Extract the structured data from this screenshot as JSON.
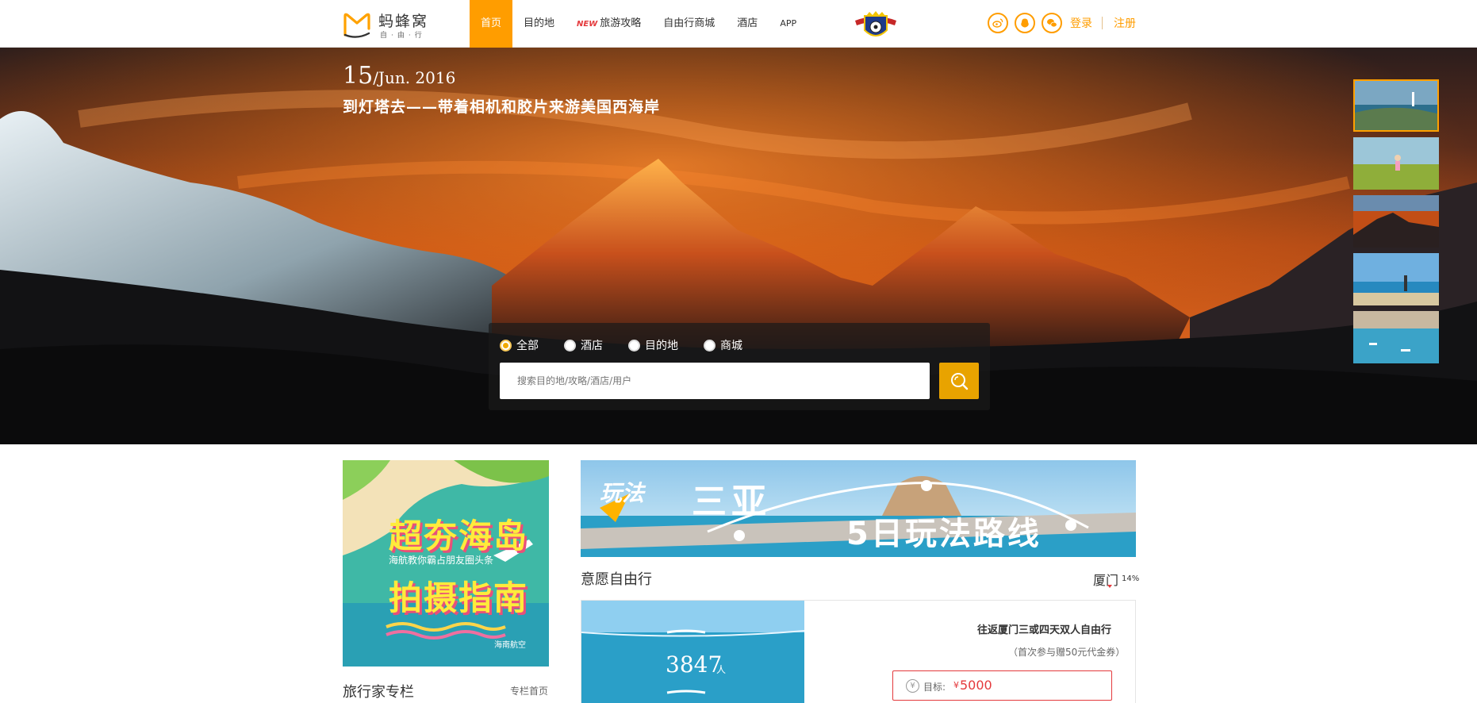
{
  "header": {
    "logo_text": "蚂蜂窝",
    "logo_sub": "自·由·行",
    "nav": [
      {
        "label": "首页",
        "active": true
      },
      {
        "label": "目的地"
      },
      {
        "label": "旅游攻略",
        "tag": "NEW"
      },
      {
        "label": "自由行商城"
      },
      {
        "label": "酒店"
      },
      {
        "label": "APP"
      }
    ],
    "social_icons": [
      "weibo-icon",
      "qq-icon",
      "wechat-icon"
    ],
    "login": "登录",
    "register": "注册",
    "accent": "#ff9d00"
  },
  "hero": {
    "day": "15",
    "month_year": "/Jun. 2016",
    "title": "到灯塔去——带着相机和胶片来游美国西海岸",
    "thumbnails": [
      "lighthouse-coast",
      "girl-in-field",
      "sunset-mountain",
      "beach-person",
      "harbor-boats"
    ],
    "search": {
      "options": [
        "全部",
        "酒店",
        "目的地",
        "商城"
      ],
      "selected": "全部",
      "placeholder": "搜索目的地/攻略/酒店/用户"
    }
  },
  "left_ad": {
    "line1": "超夯海岛",
    "sub": "海航教你霸占朋友圈头条",
    "line2": "拍摄指南",
    "brand": "海南航空"
  },
  "column": {
    "title": "旅行家专栏",
    "link": "专栏首页"
  },
  "right_ad": {
    "tag": "玩法",
    "city": "三亚",
    "route": "5日玩法路线"
  },
  "wish": {
    "title": "意愿自由行",
    "city": "厦门",
    "percent": "14%"
  },
  "card": {
    "count": "3847",
    "count_unit": "人",
    "name": "往返厦门三或四天双人自由行",
    "note": "（首次参与赠50元代金券）",
    "goal_icon": "¥",
    "goal_label": "目标:",
    "currency": "¥",
    "goal_value": "5000"
  }
}
